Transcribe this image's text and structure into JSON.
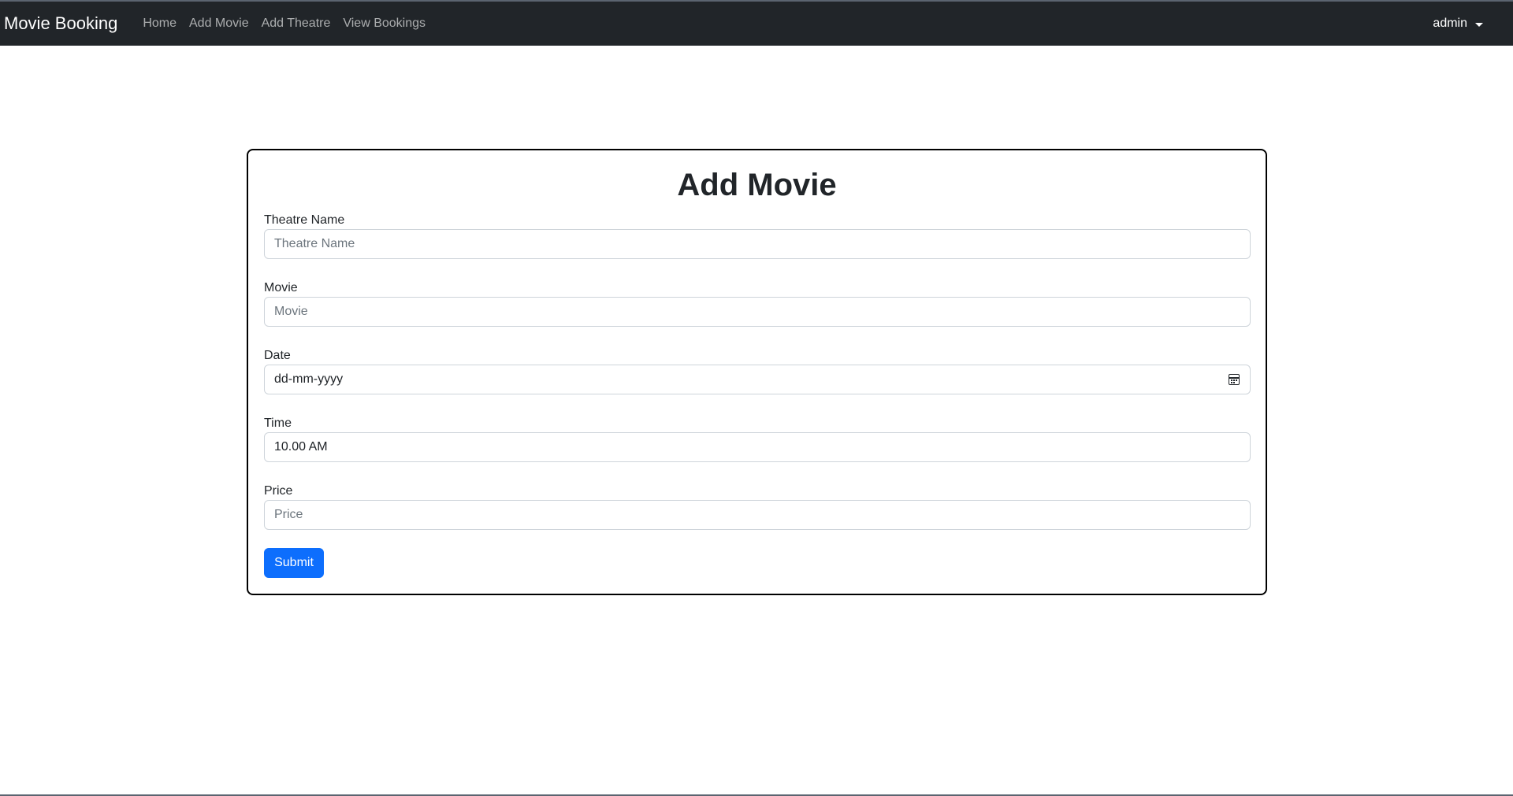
{
  "navbar": {
    "brand": "Movie Booking",
    "links": [
      "Home",
      "Add Movie",
      "Add Theatre",
      "View Bookings"
    ],
    "user": "admin"
  },
  "form": {
    "title": "Add Movie",
    "fields": {
      "theatre_name": {
        "label": "Theatre Name",
        "placeholder": "Theatre Name",
        "value": ""
      },
      "movie": {
        "label": "Movie",
        "placeholder": "Movie",
        "value": ""
      },
      "date": {
        "label": "Date",
        "value": "dd-mm-yyyy",
        "icon": "calendar-icon"
      },
      "time": {
        "label": "Time",
        "value": "10.00 AM"
      },
      "price": {
        "label": "Price",
        "placeholder": "Price",
        "value": ""
      }
    },
    "submit_label": "Submit"
  },
  "colors": {
    "navbar_bg": "#212529",
    "primary": "#0d6efd"
  }
}
